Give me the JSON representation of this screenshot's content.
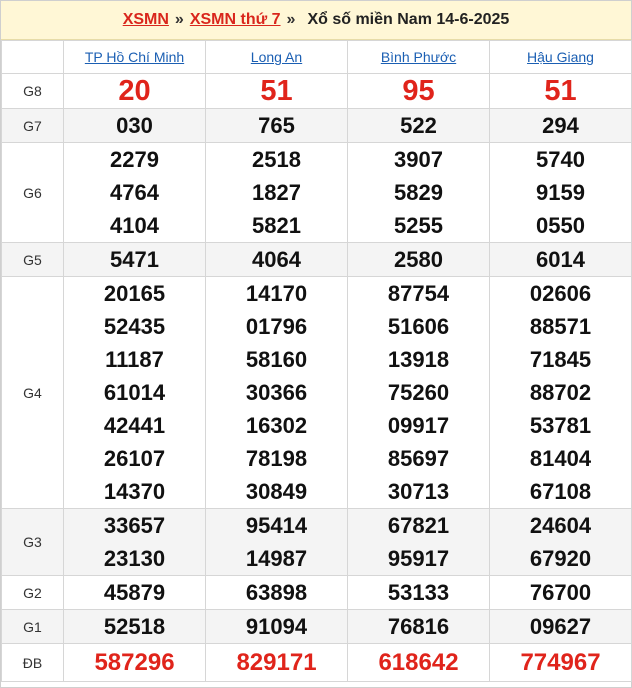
{
  "breadcrumb": {
    "link1": "XSMN",
    "sep1": "»",
    "link2": "XSMN thứ 7",
    "sep2": "»",
    "title": "Xổ số miền Nam 14-6-2025"
  },
  "provinces": [
    "TP Hồ Chí Minh",
    "Long An",
    "Bình Phước",
    "Hậu Giang"
  ],
  "prizes": [
    {
      "label": "G8",
      "style": "big",
      "values": [
        [
          "20"
        ],
        [
          "51"
        ],
        [
          "95"
        ],
        [
          "51"
        ]
      ]
    },
    {
      "label": "G7",
      "style": "num",
      "values": [
        [
          "030"
        ],
        [
          "765"
        ],
        [
          "522"
        ],
        [
          "294"
        ]
      ]
    },
    {
      "label": "G6",
      "style": "num",
      "values": [
        [
          "2279",
          "4764",
          "4104"
        ],
        [
          "2518",
          "1827",
          "5821"
        ],
        [
          "3907",
          "5829",
          "5255"
        ],
        [
          "5740",
          "9159",
          "0550"
        ]
      ]
    },
    {
      "label": "G5",
      "style": "num",
      "values": [
        [
          "5471"
        ],
        [
          "4064"
        ],
        [
          "2580"
        ],
        [
          "6014"
        ]
      ]
    },
    {
      "label": "G4",
      "style": "num",
      "values": [
        [
          "20165",
          "52435",
          "11187",
          "61014",
          "42441",
          "26107",
          "14370"
        ],
        [
          "14170",
          "01796",
          "58160",
          "30366",
          "16302",
          "78198",
          "30849"
        ],
        [
          "87754",
          "51606",
          "13918",
          "75260",
          "09917",
          "85697",
          "30713"
        ],
        [
          "02606",
          "88571",
          "71845",
          "88702",
          "53781",
          "81404",
          "67108"
        ]
      ]
    },
    {
      "label": "G3",
      "style": "num",
      "values": [
        [
          "33657",
          "23130"
        ],
        [
          "95414",
          "14987"
        ],
        [
          "67821",
          "95917"
        ],
        [
          "24604",
          "67920"
        ]
      ]
    },
    {
      "label": "G2",
      "style": "num",
      "values": [
        [
          "45879"
        ],
        [
          "63898"
        ],
        [
          "53133"
        ],
        [
          "76700"
        ]
      ]
    },
    {
      "label": "G1",
      "style": "num",
      "values": [
        [
          "52518"
        ],
        [
          "91094"
        ],
        [
          "76816"
        ],
        [
          "09627"
        ]
      ]
    },
    {
      "label": "ĐB",
      "style": "db",
      "values": [
        [
          "587296"
        ],
        [
          "829171"
        ],
        [
          "618642"
        ],
        [
          "774967"
        ]
      ]
    }
  ]
}
